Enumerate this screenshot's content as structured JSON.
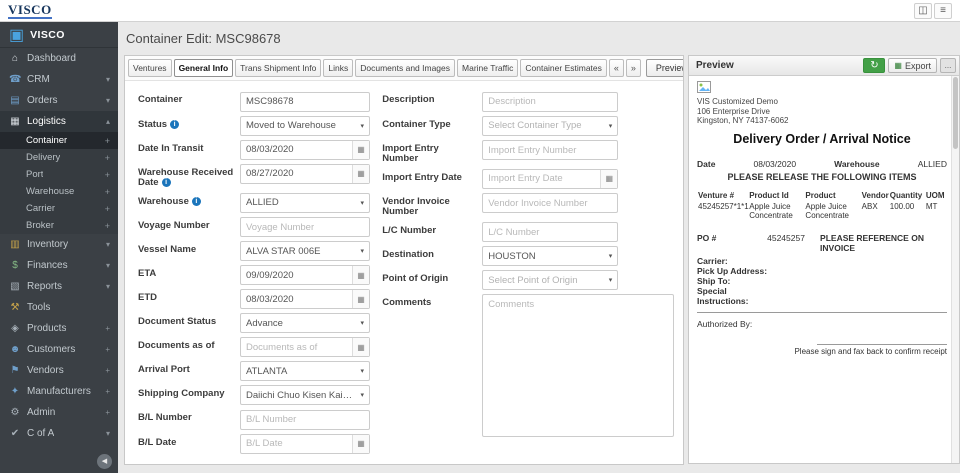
{
  "topbar": {
    "logo": "VISCO",
    "icons": [
      {
        "name": "window"
      },
      {
        "name": "menu"
      }
    ]
  },
  "colors": {
    "sidebar_bg": "#3b4045",
    "info_blue": "#1b75bb",
    "refresh_green": "#43a047",
    "logo_navy": "#17365d"
  },
  "sidebar": {
    "brand": {
      "label": "VISCO",
      "icon": "visco-logo"
    },
    "items": [
      {
        "label": "Dashboard",
        "icon": "dashboard",
        "suffix": "none"
      },
      {
        "label": "CRM",
        "icon": "crm",
        "suffix": "chevron"
      },
      {
        "label": "Orders",
        "icon": "orders",
        "suffix": "chevron"
      },
      {
        "label": "Logistics",
        "icon": "logistics",
        "suffix": "chevron-up",
        "active": true,
        "children": [
          {
            "label": "Container",
            "suffix": "plus",
            "active": true
          },
          {
            "label": "Delivery",
            "suffix": "plus"
          },
          {
            "label": "Port",
            "suffix": "plus"
          },
          {
            "label": "Warehouse",
            "suffix": "plus"
          },
          {
            "label": "Carrier",
            "suffix": "plus"
          },
          {
            "label": "Broker",
            "suffix": "plus"
          }
        ]
      },
      {
        "label": "Inventory",
        "icon": "inventory",
        "suffix": "chevron"
      },
      {
        "label": "Finances",
        "icon": "finances",
        "suffix": "chevron"
      },
      {
        "label": "Reports",
        "icon": "reports",
        "suffix": "chevron"
      },
      {
        "label": "Tools",
        "icon": "tools",
        "suffix": "none"
      },
      {
        "label": "Products",
        "icon": "products",
        "suffix": "plus"
      },
      {
        "label": "Customers",
        "icon": "customers",
        "suffix": "plus"
      },
      {
        "label": "Vendors",
        "icon": "vendors",
        "suffix": "plus"
      },
      {
        "label": "Manufacturers",
        "icon": "manufacturers",
        "suffix": "plus"
      },
      {
        "label": "Admin",
        "icon": "admin",
        "suffix": "plus"
      },
      {
        "label": "C of A",
        "icon": "cofa",
        "suffix": "chevron"
      }
    ]
  },
  "main": {
    "title": "Container Edit: MSC98678",
    "tabs": [
      {
        "label": "Ventures",
        "active": false
      },
      {
        "label": "General Info",
        "active": true
      },
      {
        "label": "Trans Shipment Info",
        "active": false
      },
      {
        "label": "Links",
        "active": false
      },
      {
        "label": "Documents and Images",
        "active": false
      },
      {
        "label": "Marine Traffic",
        "active": false
      },
      {
        "label": "Container Estimates",
        "active": false
      }
    ],
    "tab_nav": {
      "prev": "«",
      "next": "»"
    },
    "preview_button": "Preview",
    "overflow_button": "...",
    "form": {
      "left": [
        {
          "label": "Container",
          "type": "text",
          "value": "MSC98678"
        },
        {
          "label": "Status",
          "info": true,
          "type": "select",
          "value": "Moved to Warehouse"
        },
        {
          "label": "Date In Transit",
          "type": "date",
          "value": "08/03/2020"
        },
        {
          "label": "Warehouse Received Date",
          "info": true,
          "type": "date",
          "value": "08/27/2020"
        },
        {
          "label": "Warehouse",
          "info": true,
          "type": "select",
          "value": "ALLIED"
        },
        {
          "label": "Voyage Number",
          "type": "text",
          "placeholder": "Voyage Number"
        },
        {
          "label": "Vessel Name",
          "type": "select",
          "value": "ALVA STAR 006E"
        },
        {
          "label": "ETA",
          "type": "date",
          "value": "09/09/2020"
        },
        {
          "label": "ETD",
          "type": "date",
          "value": "08/03/2020"
        },
        {
          "label": "Document Status",
          "type": "select",
          "value": "Advance"
        },
        {
          "label": "Documents as of",
          "type": "date",
          "placeholder": "Documents as of"
        },
        {
          "label": "Arrival Port",
          "type": "select",
          "value": "ATLANTA"
        },
        {
          "label": "Shipping Company",
          "type": "select",
          "value": "Daiichi Chuo Kisen Kaisha - for ..."
        },
        {
          "label": "B/L Number",
          "type": "text",
          "placeholder": "B/L Number"
        },
        {
          "label": "B/L Date",
          "type": "date",
          "placeholder": "B/L Date"
        }
      ],
      "right": [
        {
          "label": "Description",
          "type": "text",
          "placeholder": "Description"
        },
        {
          "label": "Container Type",
          "type": "select",
          "placeholder": "Select Container Type"
        },
        {
          "label": "Import Entry Number",
          "type": "text",
          "placeholder": "Import Entry Number"
        },
        {
          "label": "Import Entry Date",
          "type": "date",
          "placeholder": "Import Entry Date"
        },
        {
          "label": "Vendor Invoice Number",
          "type": "text",
          "placeholder": "Vendor Invoice Number"
        },
        {
          "label": "L/C Number",
          "type": "text",
          "placeholder": "L/C Number"
        },
        {
          "label": "Destination",
          "type": "select",
          "value": "HOUSTON"
        },
        {
          "label": "Point of Origin",
          "type": "select",
          "placeholder": "Select Point of Origin"
        },
        {
          "label": "Comments",
          "type": "textarea",
          "placeholder": "Comments"
        }
      ]
    }
  },
  "preview": {
    "header": {
      "title": "Preview",
      "export_label": "Export",
      "more_label": "..."
    },
    "company": {
      "name": "VIS Customized Demo",
      "address1": "106 Enterprise Drive",
      "address2": "Kingston, NY 74137-6062"
    },
    "doc_title": "Delivery Order / Arrival Notice",
    "date_label": "Date",
    "date_value": "08/03/2020",
    "warehouse_label": "Warehouse",
    "warehouse_value": "ALLIED",
    "release_line": "PLEASE RELEASE THE FOLLOWING ITEMS",
    "items_table": {
      "columns": [
        "Venture #",
        "Product Id",
        "Product",
        "Vendor",
        "Quantity",
        "UOM"
      ],
      "rows": [
        [
          "45245257*1*1",
          "Apple Juice Concentrate",
          "Apple Juice Concentrate",
          "ABX",
          "100.00",
          "MT"
        ]
      ]
    },
    "po_label": "PO #",
    "po_value": "45245257",
    "po_note": "PLEASE REFERENCE ON INVOICE",
    "fields": [
      "Carrier:",
      "Pick Up Address:",
      "Ship To:",
      "Special Instructions:"
    ],
    "authorized_label": "Authorized By:",
    "sign_note": "Please sign and fax back to confirm receipt"
  }
}
